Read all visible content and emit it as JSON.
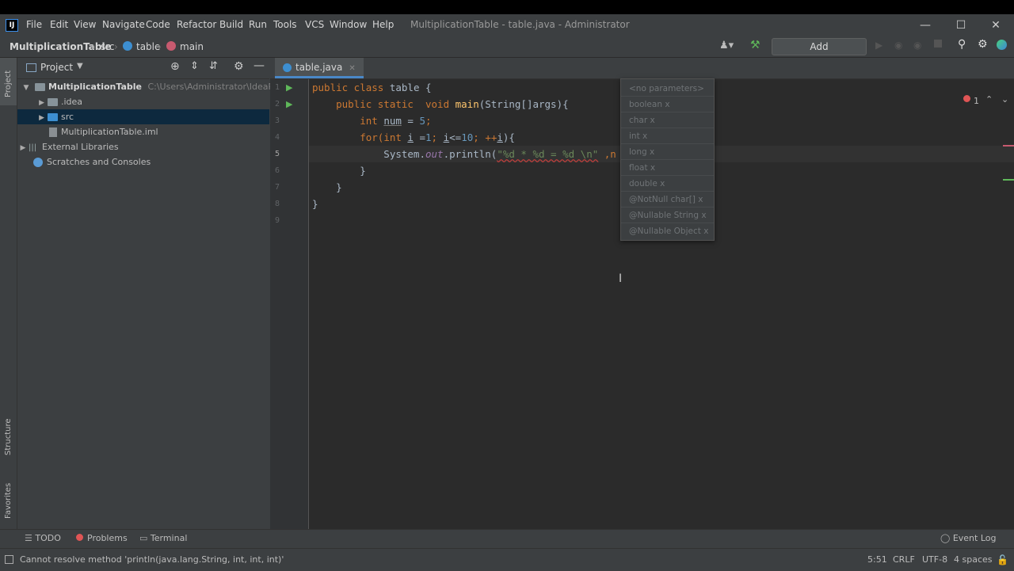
{
  "menu": {
    "logo": "IJ",
    "items": [
      "File",
      "Edit",
      "View",
      "Navigate",
      "Code",
      "Refactor",
      "Build",
      "Run",
      "Tools",
      "VCS",
      "Window",
      "Help"
    ],
    "window_title": "MultiplicationTable - table.java - Administrator"
  },
  "navbar": {
    "project": "MultiplicationTable",
    "crumb_src": "src",
    "crumb_table": "table",
    "crumb_main": "main",
    "add_configuration": "Add Configuration..."
  },
  "side_tabs": {
    "project": "Project",
    "structure": "Structure",
    "favorites": "Favorites"
  },
  "project_panel": {
    "title": "Project",
    "tree": [
      {
        "label": "MultiplicationTable",
        "hint": "C:\\Users\\Administrator\\IdeaProject"
      },
      {
        "label": ".idea"
      },
      {
        "label": "src"
      },
      {
        "label": "MultiplicationTable.iml"
      },
      {
        "label": "External Libraries"
      },
      {
        "label": "Scratches and Consoles"
      }
    ]
  },
  "editor": {
    "tab": "table.java",
    "error_count": "1",
    "line_numbers": [
      "1",
      "2",
      "3",
      "4",
      "5",
      "6",
      "7",
      "8",
      "9"
    ],
    "code": {
      "l1": {
        "a": "public class ",
        "b": "table",
        "c": " {"
      },
      "l2": {
        "a": "    public static  void ",
        "b": "main",
        "c": "(String[]args){"
      },
      "l3": {
        "a": "        int ",
        "b": "num",
        "c": " = ",
        "d": "5",
        "e": ";"
      },
      "l4": {
        "a": "        for(",
        "b": "int ",
        "c": "i",
        "d": " =",
        "e": "1",
        "f": "; ",
        "g": "i",
        "h": "<=",
        "i": "10",
        "j": "; ++",
        "k": "i",
        "l": "){"
      },
      "l5": {
        "a": "            System.",
        "b": "out",
        "c": ".println(",
        "d": "\"%d * %d = %d \\n\"",
        "e": " ,n"
      },
      "l6": "        }",
      "l7": "    }",
      "l8": "}"
    }
  },
  "param_popup": {
    "items": [
      "<no parameters>",
      "boolean x",
      "char x",
      "int x",
      "long x",
      "float x",
      "double x",
      "@NotNull char[] x",
      "@Nullable String x",
      "@Nullable Object x"
    ]
  },
  "tool_windows": {
    "todo": "TODO",
    "problems": "Problems",
    "terminal": "Terminal",
    "event_log": "Event Log"
  },
  "status": {
    "message": "Cannot resolve method 'println(java.lang.String, int, int, int)'",
    "position": "5:51",
    "line_sep": "CRLF",
    "encoding": "UTF-8",
    "indent": "4 spaces"
  },
  "colors": {
    "error": "#e05555",
    "accent": "#4a88c7",
    "keyword": "#cc7832",
    "string": "#6a8759"
  }
}
